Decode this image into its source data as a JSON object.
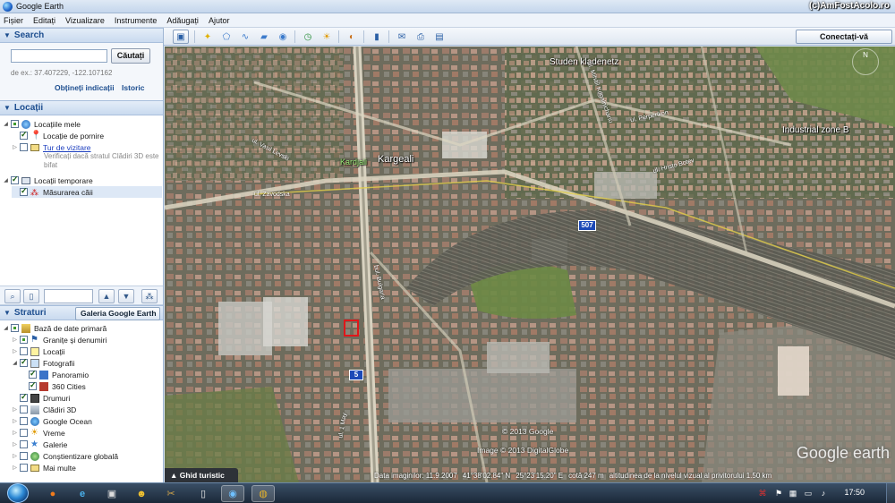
{
  "window": {
    "title": "Google Earth",
    "watermark": "(c)AmFostAcolo.ro"
  },
  "menu": [
    "Fișier",
    "Editați",
    "Vizualizare",
    "Instrumente",
    "Adăugați",
    "Ajutor"
  ],
  "search": {
    "header": "Search",
    "input_value": "",
    "button": "Căutați",
    "hint": "de ex.: 37.407229, -122.107162",
    "directions_link": "Obțineți indicații",
    "history_link": "Istoric"
  },
  "locations": {
    "header": "Locații",
    "items": [
      {
        "label": "Locațiile mele"
      },
      {
        "label": "Locație de pornire"
      },
      {
        "label": "Tur de vizitare"
      },
      {
        "note": "Verificați dacă stratul Clădiri 3D este bifat"
      },
      {
        "label": "Locații temporare"
      },
      {
        "label": "Măsurarea căii"
      }
    ]
  },
  "layers": {
    "header": "Straturi",
    "gallery_button": "Galeria Google Earth",
    "gallery_chevron": "»",
    "items": [
      {
        "label": "Bază de date primară"
      },
      {
        "label": "Granițe și denumiri"
      },
      {
        "label": "Locații"
      },
      {
        "label": "Fotografii"
      },
      {
        "label": "Panoramio"
      },
      {
        "label": "360 Cities"
      },
      {
        "label": "Drumuri"
      },
      {
        "label": "Clădiri 3D"
      },
      {
        "label": "Google Ocean"
      },
      {
        "label": "Vreme"
      },
      {
        "label": "Galerie"
      },
      {
        "label": "Conștientizare globală"
      },
      {
        "label": "Mai multe"
      }
    ]
  },
  "toolbar": {
    "connect_button": "Conectați-vă"
  },
  "map": {
    "places": [
      "Studen kladenetz",
      "Industrial zone B",
      "Kargeali",
      "Kardjali"
    ],
    "streets": [
      "ul. Vasil Levski",
      "ul. Zavodska",
      "bul. Bulgaria",
      "ul. 1 May",
      "ul. Perperikon",
      "ul. Mihail Kogalnichanu",
      "ul. Hristo Botev"
    ],
    "road_shields": [
      "507",
      "5"
    ],
    "copyright": [
      "© 2013 Google",
      "Image © 2013 DigitalGlobe"
    ],
    "logo": "Google earth",
    "compass": "N",
    "tour_tab": "Ghid turistic",
    "status": {
      "date": "Data imaginilor: 11.9.2007",
      "lat": "41°38'02.84\" N",
      "lon": "25°23'15.20\" E",
      "elevation": "cotă    247 m",
      "eye_alt": "altitudinea de la nivelul vizual al privitorului    1.50 km"
    }
  },
  "taskbar": {
    "clock": "17:50"
  }
}
